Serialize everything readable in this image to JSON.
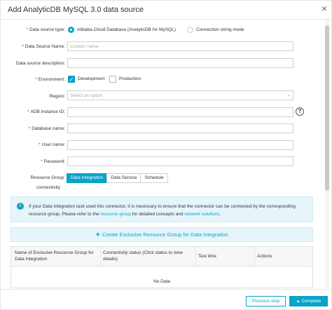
{
  "dialog": {
    "title": "Add AnalyticDB MySQL 3.0 data source",
    "close_glyph": "×"
  },
  "form": {
    "data_source_type": {
      "label": "Data source type",
      "options": [
        "Alibaba Cloud Database (AnalyticDB for MySQL)",
        "Connection string mode"
      ],
      "selected": "Alibaba Cloud Database (AnalyticDB for MySQL)"
    },
    "data_source_name": {
      "label": "Data Source Name",
      "placeholder": "Custom name"
    },
    "data_source_description": {
      "label": "Data source description",
      "value": ""
    },
    "environment": {
      "label": "Environment",
      "options": [
        {
          "label": "Development",
          "checked": true
        },
        {
          "label": "Production",
          "checked": false
        }
      ]
    },
    "region": {
      "label": "Region",
      "placeholder": "Select an option"
    },
    "adb_instance_id": {
      "label": "ADB instance ID",
      "value": ""
    },
    "database_name": {
      "label": "Database name",
      "value": ""
    },
    "user_name": {
      "label": "User name",
      "value": ""
    },
    "password": {
      "label": "Password",
      "value": ""
    },
    "resource_group": {
      "label_line1": "Resource Group",
      "label_line2": "connectivity",
      "tabs": [
        "Data Integration",
        "Data Service",
        "Schedule"
      ],
      "active_tab": "Data Integration"
    }
  },
  "info": {
    "icon": "i",
    "text_before": "If your Data Integration task used this connector, it is necessary to ensure that the connector can be connected by the corresponding resource group. Please refer to the ",
    "link1": "resource group",
    "text_middle": " for detailed concepts and ",
    "link2": "network solutions",
    "text_after": "."
  },
  "create_button": {
    "plus": "+",
    "label": "Create Exclusive Resource Group for Data Integration"
  },
  "table": {
    "columns": [
      "Name of Exclusive Resource Group for Data Integration",
      "Connectivity status (Click status to view details)",
      "Test time",
      "Actions"
    ],
    "empty_text": "No Data"
  },
  "footer": {
    "previous_label": "Previous step",
    "complete_label": "Complete",
    "complete_icon": "▲"
  },
  "colors": {
    "accent": "#0aa3c8",
    "required": "#e02020",
    "info_bg": "#e5f5fa"
  },
  "icons": [
    "close-icon",
    "chevron-down-icon",
    "help-icon",
    "info-icon",
    "plus-icon",
    "check-icon"
  ]
}
